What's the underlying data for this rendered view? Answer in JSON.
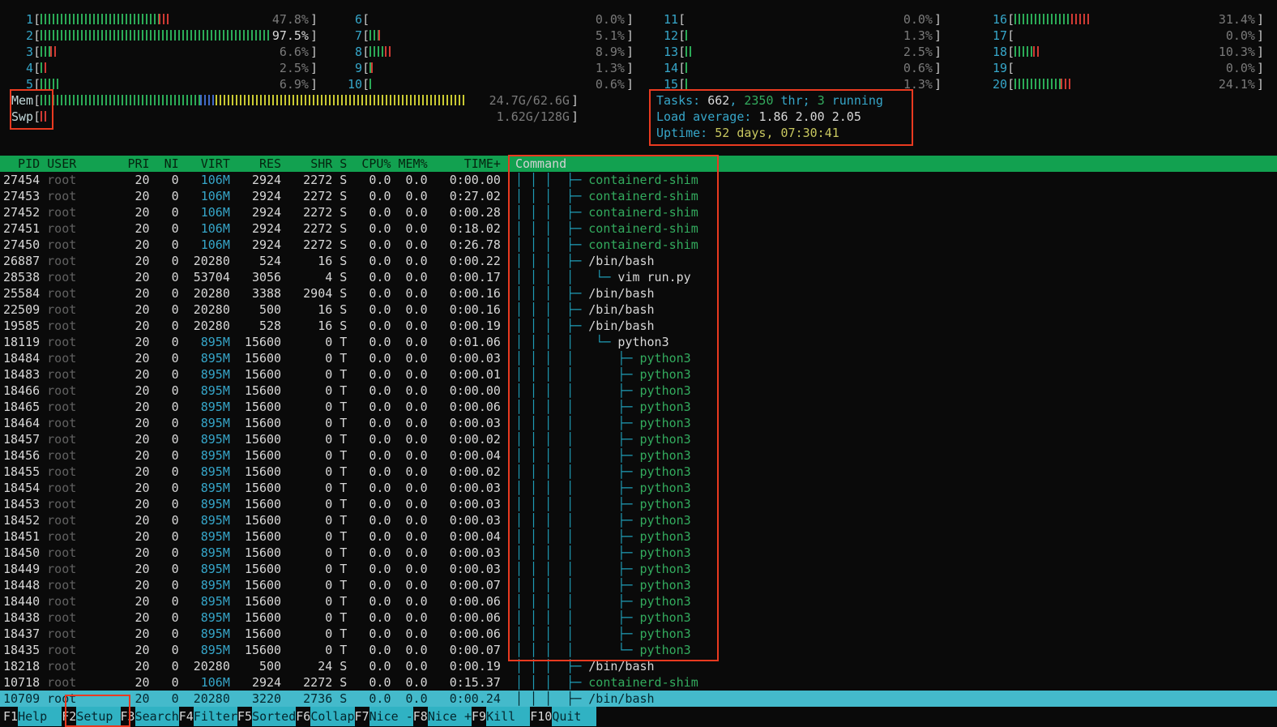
{
  "meters": {
    "cpus": [
      {
        "n": "1",
        "pct": 47.8,
        "red": 4,
        "text": "47.8%"
      },
      {
        "n": "2",
        "pct": 97.5,
        "red": 2,
        "text": "97.5%",
        "bright": true
      },
      {
        "n": "3",
        "pct": 6.6,
        "red": 3,
        "text": "6.6%"
      },
      {
        "n": "4",
        "pct": 2.5,
        "red": 1,
        "text": "2.5%"
      },
      {
        "n": "5",
        "pct": 6.9,
        "text": "6.9%"
      },
      {
        "n": "6",
        "pct": 0.0,
        "text": "0.0%"
      },
      {
        "n": "7",
        "pct": 5.1,
        "red": 1.6,
        "text": "5.1%"
      },
      {
        "n": "8",
        "pct": 8.9,
        "red": 3,
        "text": "8.9%"
      },
      {
        "n": "9",
        "pct": 1.3,
        "red": 0.6,
        "text": "1.3%"
      },
      {
        "n": "10",
        "pct": 0.6,
        "text": "0.6%"
      },
      {
        "n": "11",
        "pct": 0.0,
        "text": "0.0%"
      },
      {
        "n": "12",
        "pct": 1.3,
        "text": "1.3%"
      },
      {
        "n": "13",
        "pct": 2.5,
        "text": "2.5%"
      },
      {
        "n": "14",
        "pct": 0.6,
        "text": "0.6%"
      },
      {
        "n": "15",
        "pct": 1.3,
        "text": "1.3%"
      },
      {
        "n": "16",
        "pct": 31.4,
        "red": 8,
        "text": "31.4%"
      },
      {
        "n": "17",
        "pct": 0.0,
        "text": "0.0%"
      },
      {
        "n": "18",
        "pct": 10.3,
        "red": 2.5,
        "text": "10.3%"
      },
      {
        "n": "19",
        "pct": 0.0,
        "text": "0.0%"
      },
      {
        "n": "20",
        "pct": 24.1,
        "red": 5,
        "text": "24.1%"
      }
    ],
    "mem": {
      "label": "Mem",
      "text": "24.7G/62.6G",
      "segs": [
        [
          "green",
          30
        ],
        [
          "blue",
          3
        ],
        [
          "yellow",
          47
        ]
      ]
    },
    "swp": {
      "label": "Swp",
      "text": "1.62G/128G",
      "segs": [
        [
          "red",
          1.3
        ]
      ]
    }
  },
  "tasks_panel": {
    "lines": [
      [
        [
          "Tasks: ",
          "cyan"
        ],
        [
          "662",
          "white"
        ],
        [
          ", ",
          "cyan"
        ],
        [
          "2350",
          "green"
        ],
        [
          " thr",
          "cyan"
        ],
        [
          "; ",
          "cyan"
        ],
        [
          "3",
          "green"
        ],
        [
          " running",
          "cyan"
        ]
      ],
      [
        [
          "Load average: ",
          "cyan"
        ],
        [
          "1.86 2.00 2.05",
          "white"
        ]
      ],
      [
        [
          "Uptime: ",
          "cyan"
        ],
        [
          "52 days, 07:30:41",
          "yellow"
        ]
      ]
    ]
  },
  "table": {
    "headers": [
      "PID",
      "USER",
      "PRI",
      "NI",
      "VIRT",
      "RES",
      "SHR",
      "S",
      "CPU%",
      "MEM%",
      "TIME+",
      "Command"
    ],
    "tree_prefixes": {
      "p1": "│ │ │  ├─ ",
      "p2": "│ │ │  │   └─ ",
      "p3": "│ │ │  │      ├─ ",
      "p3l": "│ │ │  │      └─ "
    },
    "rows": [
      [
        "27454",
        "root",
        "20",
        "0",
        "106M",
        "2924",
        "2272",
        "S",
        "0.0",
        "0.0",
        "0:00.00",
        "p1",
        "containerd-shim",
        "green",
        false
      ],
      [
        "27453",
        "root",
        "20",
        "0",
        "106M",
        "2924",
        "2272",
        "S",
        "0.0",
        "0.0",
        "0:27.02",
        "p1",
        "containerd-shim",
        "green",
        false
      ],
      [
        "27452",
        "root",
        "20",
        "0",
        "106M",
        "2924",
        "2272",
        "S",
        "0.0",
        "0.0",
        "0:00.28",
        "p1",
        "containerd-shim",
        "green",
        false
      ],
      [
        "27451",
        "root",
        "20",
        "0",
        "106M",
        "2924",
        "2272",
        "S",
        "0.0",
        "0.0",
        "0:18.02",
        "p1",
        "containerd-shim",
        "green",
        false
      ],
      [
        "27450",
        "root",
        "20",
        "0",
        "106M",
        "2924",
        "2272",
        "S",
        "0.0",
        "0.0",
        "0:26.78",
        "p1",
        "containerd-shim",
        "green",
        false
      ],
      [
        "26887",
        "root",
        "20",
        "0",
        "20280",
        "524",
        "16",
        "S",
        "0.0",
        "0.0",
        "0:00.22",
        "p1",
        "/bin/bash",
        "white",
        false
      ],
      [
        "28538",
        "root",
        "20",
        "0",
        "53704",
        "3056",
        "4",
        "S",
        "0.0",
        "0.0",
        "0:00.17",
        "p2",
        "vim run.py",
        "white",
        false
      ],
      [
        "25584",
        "root",
        "20",
        "0",
        "20280",
        "3388",
        "2904",
        "S",
        "0.0",
        "0.0",
        "0:00.16",
        "p1",
        "/bin/bash",
        "white",
        false
      ],
      [
        "22509",
        "root",
        "20",
        "0",
        "20280",
        "500",
        "16",
        "S",
        "0.0",
        "0.0",
        "0:00.16",
        "p1",
        "/bin/bash",
        "white",
        false
      ],
      [
        "19585",
        "root",
        "20",
        "0",
        "20280",
        "528",
        "16",
        "S",
        "0.0",
        "0.0",
        "0:00.19",
        "p1",
        "/bin/bash",
        "white",
        false
      ],
      [
        "18119",
        "root",
        "20",
        "0",
        "895M",
        "15600",
        "0",
        "T",
        "0.0",
        "0.0",
        "0:01.06",
        "p2",
        "python3",
        "white",
        false
      ],
      [
        "18484",
        "root",
        "20",
        "0",
        "895M",
        "15600",
        "0",
        "T",
        "0.0",
        "0.0",
        "0:00.03",
        "p3",
        "python3",
        "green",
        false
      ],
      [
        "18483",
        "root",
        "20",
        "0",
        "895M",
        "15600",
        "0",
        "T",
        "0.0",
        "0.0",
        "0:00.01",
        "p3",
        "python3",
        "green",
        false
      ],
      [
        "18466",
        "root",
        "20",
        "0",
        "895M",
        "15600",
        "0",
        "T",
        "0.0",
        "0.0",
        "0:00.00",
        "p3",
        "python3",
        "green",
        false
      ],
      [
        "18465",
        "root",
        "20",
        "0",
        "895M",
        "15600",
        "0",
        "T",
        "0.0",
        "0.0",
        "0:00.06",
        "p3",
        "python3",
        "green",
        false
      ],
      [
        "18464",
        "root",
        "20",
        "0",
        "895M",
        "15600",
        "0",
        "T",
        "0.0",
        "0.0",
        "0:00.03",
        "p3",
        "python3",
        "green",
        false
      ],
      [
        "18457",
        "root",
        "20",
        "0",
        "895M",
        "15600",
        "0",
        "T",
        "0.0",
        "0.0",
        "0:00.02",
        "p3",
        "python3",
        "green",
        false
      ],
      [
        "18456",
        "root",
        "20",
        "0",
        "895M",
        "15600",
        "0",
        "T",
        "0.0",
        "0.0",
        "0:00.04",
        "p3",
        "python3",
        "green",
        false
      ],
      [
        "18455",
        "root",
        "20",
        "0",
        "895M",
        "15600",
        "0",
        "T",
        "0.0",
        "0.0",
        "0:00.02",
        "p3",
        "python3",
        "green",
        false
      ],
      [
        "18454",
        "root",
        "20",
        "0",
        "895M",
        "15600",
        "0",
        "T",
        "0.0",
        "0.0",
        "0:00.03",
        "p3",
        "python3",
        "green",
        false
      ],
      [
        "18453",
        "root",
        "20",
        "0",
        "895M",
        "15600",
        "0",
        "T",
        "0.0",
        "0.0",
        "0:00.03",
        "p3",
        "python3",
        "green",
        false
      ],
      [
        "18452",
        "root",
        "20",
        "0",
        "895M",
        "15600",
        "0",
        "T",
        "0.0",
        "0.0",
        "0:00.03",
        "p3",
        "python3",
        "green",
        false
      ],
      [
        "18451",
        "root",
        "20",
        "0",
        "895M",
        "15600",
        "0",
        "T",
        "0.0",
        "0.0",
        "0:00.04",
        "p3",
        "python3",
        "green",
        false
      ],
      [
        "18450",
        "root",
        "20",
        "0",
        "895M",
        "15600",
        "0",
        "T",
        "0.0",
        "0.0",
        "0:00.03",
        "p3",
        "python3",
        "green",
        false
      ],
      [
        "18449",
        "root",
        "20",
        "0",
        "895M",
        "15600",
        "0",
        "T",
        "0.0",
        "0.0",
        "0:00.03",
        "p3",
        "python3",
        "green",
        false
      ],
      [
        "18448",
        "root",
        "20",
        "0",
        "895M",
        "15600",
        "0",
        "T",
        "0.0",
        "0.0",
        "0:00.07",
        "p3",
        "python3",
        "green",
        false
      ],
      [
        "18440",
        "root",
        "20",
        "0",
        "895M",
        "15600",
        "0",
        "T",
        "0.0",
        "0.0",
        "0:00.06",
        "p3",
        "python3",
        "green",
        false
      ],
      [
        "18438",
        "root",
        "20",
        "0",
        "895M",
        "15600",
        "0",
        "T",
        "0.0",
        "0.0",
        "0:00.06",
        "p3",
        "python3",
        "green",
        false
      ],
      [
        "18437",
        "root",
        "20",
        "0",
        "895M",
        "15600",
        "0",
        "T",
        "0.0",
        "0.0",
        "0:00.06",
        "p3",
        "python3",
        "green",
        false
      ],
      [
        "18435",
        "root",
        "20",
        "0",
        "895M",
        "15600",
        "0",
        "T",
        "0.0",
        "0.0",
        "0:00.07",
        "p3l",
        "python3",
        "green",
        false
      ],
      [
        "18218",
        "root",
        "20",
        "0",
        "20280",
        "500",
        "24",
        "S",
        "0.0",
        "0.0",
        "0:00.19",
        "p1",
        "/bin/bash",
        "white",
        false
      ],
      [
        "10718",
        "root",
        "20",
        "0",
        "106M",
        "2924",
        "2272",
        "S",
        "0.0",
        "0.0",
        "0:15.37",
        "p1",
        "containerd-shim",
        "green",
        false
      ],
      [
        "10709",
        "root",
        "20",
        "0",
        "20280",
        "3220",
        "2736",
        "S",
        "0.0",
        "0.0",
        "0:00.24",
        "p1",
        "/bin/bash",
        "white",
        true
      ]
    ]
  },
  "fnbar": {
    "items": [
      [
        "F1",
        "Help"
      ],
      [
        "F2",
        "Setup"
      ],
      [
        "F3",
        "Search"
      ],
      [
        "F4",
        "Filter"
      ],
      [
        "F5",
        "Sorted"
      ],
      [
        "F6",
        "Collap"
      ],
      [
        "F7",
        "Nice -"
      ],
      [
        "F8",
        "Nice +"
      ],
      [
        "F9",
        "Kill"
      ],
      [
        "F10",
        "Quit"
      ]
    ]
  },
  "annotations": {
    "color": "#ea3a20",
    "boxes": [
      "mem-swp-labels",
      "tasks-panel",
      "command-tree",
      "f2-setup"
    ]
  }
}
